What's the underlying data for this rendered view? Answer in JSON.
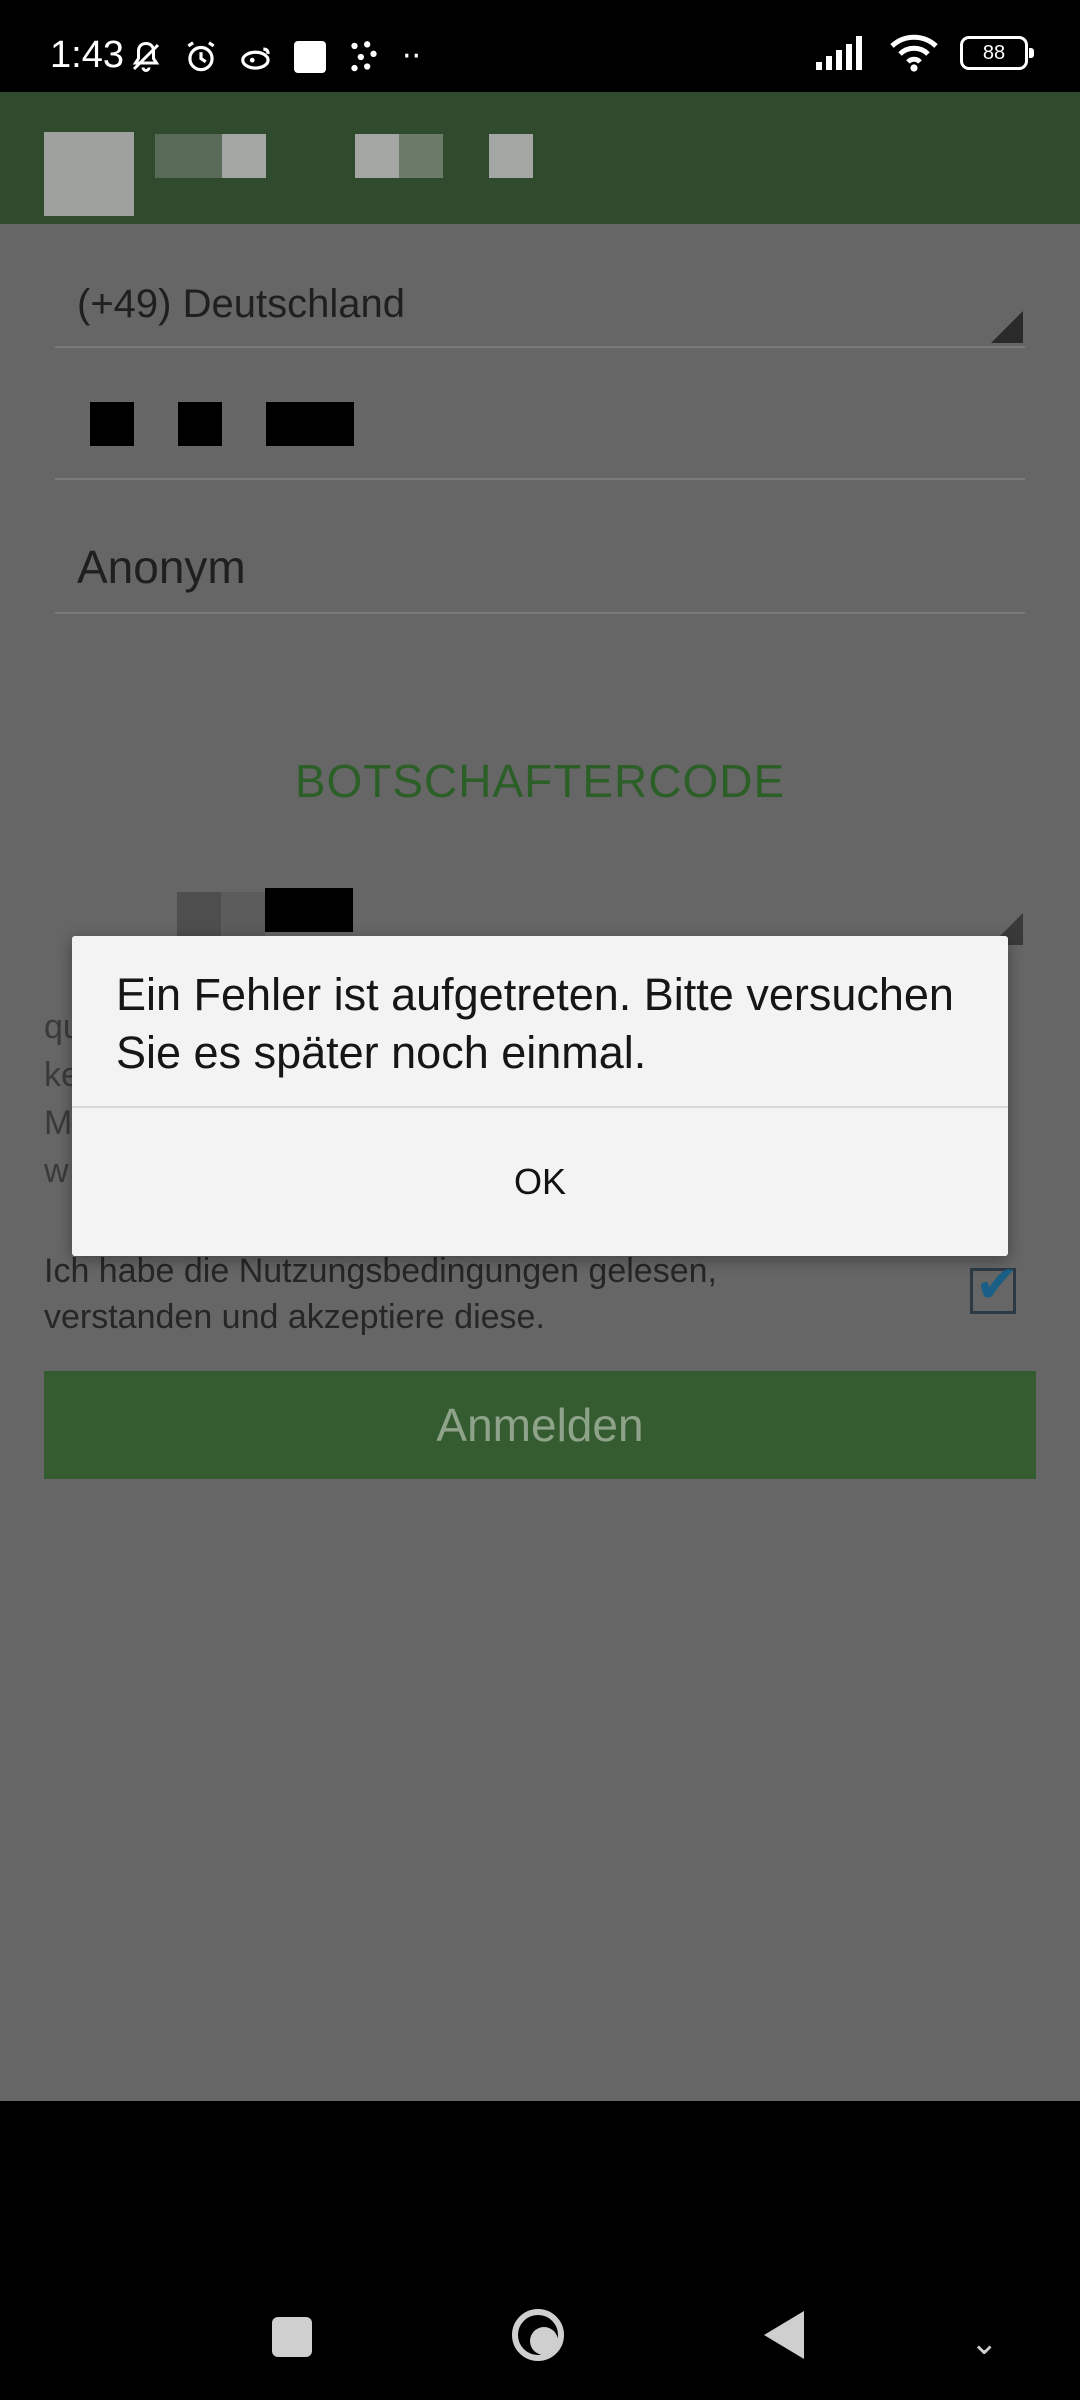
{
  "status_bar": {
    "time": "1:43",
    "battery": "88"
  },
  "form": {
    "country": "(+49) Deutschland",
    "name": "Anonym",
    "ambassador_code_label": "BOTSCHAFTERCODE",
    "hidden_text_lines": [
      "qu",
      "ke",
      "M",
      "w"
    ],
    "terms_text": "Ich habe die Nutzungsbedingungen gelesen, verstanden und akzeptiere diese.",
    "terms_checked": true,
    "login_button": "Anmelden"
  },
  "dialog": {
    "message": "Ein Fehler ist aufgetreten. Bitte versuchen Sie es später noch einmal.",
    "ok_label": "OK"
  },
  "colors": {
    "appbar": "#2f4a2c",
    "accent": "#355c30",
    "dim_overlay": "#666666"
  }
}
